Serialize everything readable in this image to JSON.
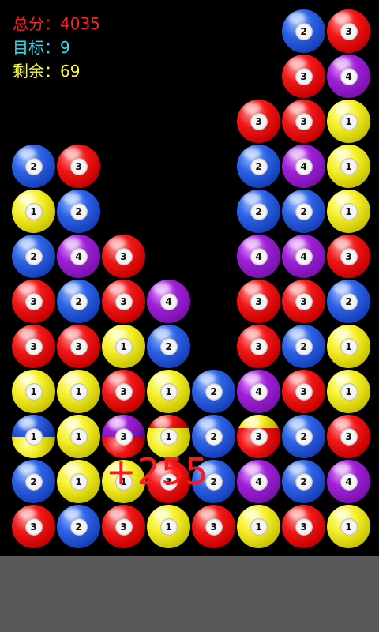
{
  "hud": {
    "score_label": "总分：",
    "score_value": "4035",
    "target_label": "目标：",
    "target_value": "9",
    "remaining_label": "剩余：",
    "remaining_value": "69"
  },
  "floating_score": "+255",
  "colors": {
    "1": "#f5f02a",
    "2": "#2d63e6",
    "3": "#f01818",
    "4": "#9e20d6"
  },
  "board": {
    "columns": 8,
    "rows": 12,
    "cells": [
      [
        0,
        0,
        0,
        0,
        0,
        0,
        "2",
        "3"
      ],
      [
        0,
        0,
        0,
        0,
        0,
        0,
        "3",
        "4"
      ],
      [
        0,
        0,
        0,
        0,
        0,
        "3",
        "3",
        "1"
      ],
      [
        "2",
        "3",
        0,
        0,
        0,
        "2",
        "4",
        "1"
      ],
      [
        "1",
        "2",
        0,
        0,
        0,
        "2",
        "2",
        "1"
      ],
      [
        "2",
        "4",
        "3",
        0,
        0,
        "4",
        "4",
        "3"
      ],
      [
        "3",
        "2",
        "3",
        "4",
        0,
        "3",
        "3",
        "2"
      ],
      [
        "3",
        "3",
        "1",
        "2",
        0,
        "3",
        "2",
        "1"
      ],
      [
        "1",
        "1",
        "3",
        "1",
        "2",
        "4",
        "3",
        "1"
      ],
      [
        {
          "top": "2",
          "bottom": "1",
          "num": "1",
          "split": 0.5
        },
        "1",
        {
          "top": "4",
          "bottom": "3",
          "num": "3",
          "split": 0.5
        },
        {
          "top": "3",
          "bottom": "1",
          "num": "1",
          "split": 0.3
        },
        "2",
        {
          "top": "1",
          "bottom": "3",
          "num": "3",
          "split": 0.3
        },
        "2",
        "3"
      ],
      [
        "2",
        "1",
        {
          "top": "1",
          "bottom": "1",
          "num": "1",
          "split": 0
        },
        {
          "top": "3",
          "bottom": "3",
          "num": "3",
          "split": 0
        },
        "2",
        "4",
        "2",
        "4"
      ],
      [
        "3",
        "2",
        "3",
        "1",
        "3",
        "1",
        "3",
        "1"
      ]
    ]
  }
}
